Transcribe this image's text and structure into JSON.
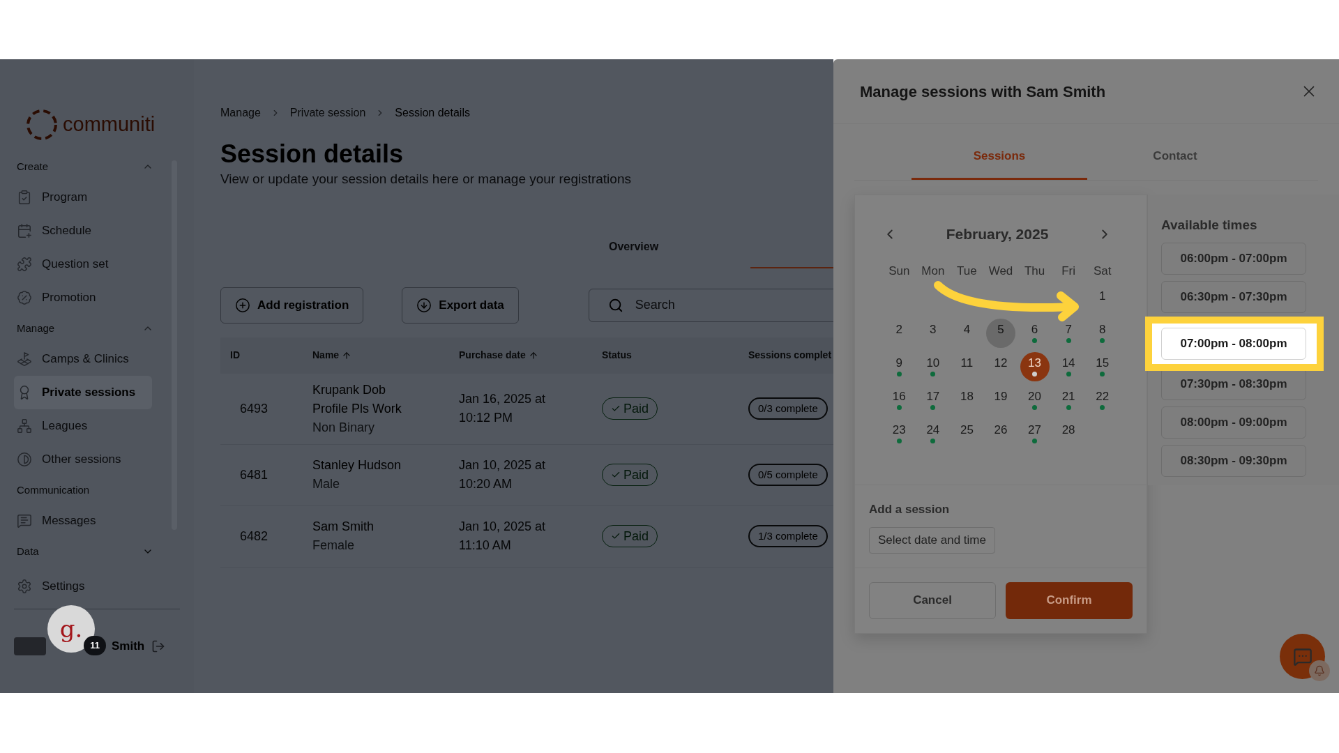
{
  "sidebar": {
    "logo_text": "communiti",
    "sections": [
      {
        "title": "Create",
        "expanded": true,
        "items": [
          {
            "label": "Program",
            "selected": false
          },
          {
            "label": "Schedule",
            "selected": false
          },
          {
            "label": "Question set",
            "selected": false
          },
          {
            "label": "Promotion",
            "selected": false
          }
        ]
      },
      {
        "title": "Manage",
        "expanded": true,
        "items": [
          {
            "label": "Camps & Clinics",
            "selected": false
          },
          {
            "label": "Private sessions",
            "selected": true
          },
          {
            "label": "Leagues",
            "selected": false
          },
          {
            "label": "Other sessions",
            "selected": false
          }
        ]
      },
      {
        "title": "Communication",
        "items": [
          {
            "label": "Messages",
            "selected": false
          }
        ]
      },
      {
        "title": "Data",
        "expanded": false
      }
    ],
    "settings": "Settings",
    "user": {
      "name": "Smith"
    },
    "helper_bubble": {
      "text": "g.",
      "badge": "11"
    }
  },
  "main": {
    "breadcrumbs": [
      "Manage",
      "Private session",
      "Session details"
    ],
    "title": "Session details",
    "subtitle": "View or update your session details here or manage your registrations",
    "tabs": [
      {
        "label": "Overview",
        "selected": false
      }
    ],
    "actions": [
      "Add registration",
      "Export data"
    ],
    "search": {
      "placeholder": "Search"
    },
    "table": {
      "columns": [
        {
          "label": "ID",
          "sorted": false
        },
        {
          "label": "Name",
          "sorted": true
        },
        {
          "label": "Purchase date",
          "sorted": true
        },
        {
          "label": "Status",
          "sorted": false
        },
        {
          "label": "Sessions complet",
          "sorted": false
        }
      ],
      "rows": [
        {
          "id": "6493",
          "name": "Krupank Dob Profile Pls Work",
          "gender": "Non Binary",
          "purchase_date": "Jan 16, 2025 at 10:12 PM",
          "status": "Paid",
          "sessions": "0/3 complete"
        },
        {
          "id": "6481",
          "name": "Stanley Hudson",
          "gender": "Male",
          "purchase_date": "Jan 10, 2025 at 10:20 AM",
          "status": "Paid",
          "sessions": "0/5 complete"
        },
        {
          "id": "6482",
          "name": "Sam Smith",
          "gender": "Female",
          "purchase_date": "Jan 10, 2025 at 11:10 AM",
          "status": "Paid",
          "sessions": "1/3 complete"
        }
      ]
    }
  },
  "modal": {
    "title": "Manage sessions with Sam Smith",
    "tabs": [
      {
        "label": "Sessions",
        "selected": true
      },
      {
        "label": "Contact",
        "selected": false
      }
    ],
    "calendar": {
      "month": "February, 2025",
      "weekdays": [
        "Sun",
        "Mon",
        "Tue",
        "Wed",
        "Thu",
        "Fri",
        "Sat"
      ],
      "weeks": [
        [
          {
            "label": "1",
            "has_sessions": false,
            "selected": false,
            "today": false
          }
        ],
        [
          {
            "label": "2",
            "has_sessions": false,
            "selected": false,
            "today": false
          },
          {
            "label": "3",
            "has_sessions": false,
            "selected": false,
            "today": false
          },
          {
            "label": "4",
            "has_sessions": false,
            "selected": false,
            "today": false
          },
          {
            "label": "5",
            "has_sessions": false,
            "selected": false,
            "today": true
          },
          {
            "label": "6",
            "has_sessions": true,
            "selected": false,
            "today": false
          },
          {
            "label": "7",
            "has_sessions": true,
            "selected": false,
            "today": false
          },
          {
            "label": "8",
            "has_sessions": true,
            "selected": false,
            "today": false
          }
        ],
        [
          {
            "label": "9",
            "has_sessions": true,
            "selected": false,
            "today": false
          },
          {
            "label": "10",
            "has_sessions": true,
            "selected": false,
            "today": false
          },
          {
            "label": "11",
            "has_sessions": false,
            "selected": false,
            "today": false
          },
          {
            "label": "12",
            "has_sessions": false,
            "selected": false,
            "today": false
          },
          {
            "label": "13",
            "has_sessions": true,
            "selected": true,
            "today": false
          },
          {
            "label": "14",
            "has_sessions": true,
            "selected": false,
            "today": false
          },
          {
            "label": "15",
            "has_sessions": true,
            "selected": false,
            "today": false
          }
        ],
        [
          {
            "label": "16",
            "has_sessions": true,
            "selected": false,
            "today": false
          },
          {
            "label": "17",
            "has_sessions": true,
            "selected": false,
            "today": false
          },
          {
            "label": "18",
            "has_sessions": false,
            "selected": false,
            "today": false
          },
          {
            "label": "19",
            "has_sessions": false,
            "selected": false,
            "today": false
          },
          {
            "label": "20",
            "has_sessions": true,
            "selected": false,
            "today": false
          },
          {
            "label": "21",
            "has_sessions": true,
            "selected": false,
            "today": false
          },
          {
            "label": "22",
            "has_sessions": true,
            "selected": false,
            "today": false
          }
        ],
        [
          {
            "label": "23",
            "has_sessions": true,
            "selected": false,
            "today": false
          },
          {
            "label": "24",
            "has_sessions": true,
            "selected": false,
            "today": false
          },
          {
            "label": "25",
            "has_sessions": false,
            "selected": false,
            "today": false
          },
          {
            "label": "26",
            "has_sessions": false,
            "selected": false,
            "today": false
          },
          {
            "label": "27",
            "has_sessions": true,
            "selected": false,
            "today": false
          },
          {
            "label": "28",
            "has_sessions": false,
            "selected": false,
            "today": false
          }
        ]
      ]
    },
    "times": {
      "title": "Available times",
      "slots": [
        {
          "label": "06:00pm - 07:00pm",
          "selected": false
        },
        {
          "label": "06:30pm - 07:30pm",
          "selected": false
        },
        {
          "label": "07:00pm - 08:00pm",
          "selected": true
        },
        {
          "label": "07:30pm - 08:30pm",
          "selected": false
        },
        {
          "label": "08:00pm - 09:00pm",
          "selected": false
        },
        {
          "label": "08:30pm - 09:30pm",
          "selected": false
        }
      ]
    },
    "add_session": {
      "title": "Add a session",
      "button": "Select date and time"
    },
    "buttons": [
      {
        "label": "Cancel",
        "kind": "secondary"
      },
      {
        "label": "Confirm",
        "kind": "primary"
      }
    ]
  }
}
